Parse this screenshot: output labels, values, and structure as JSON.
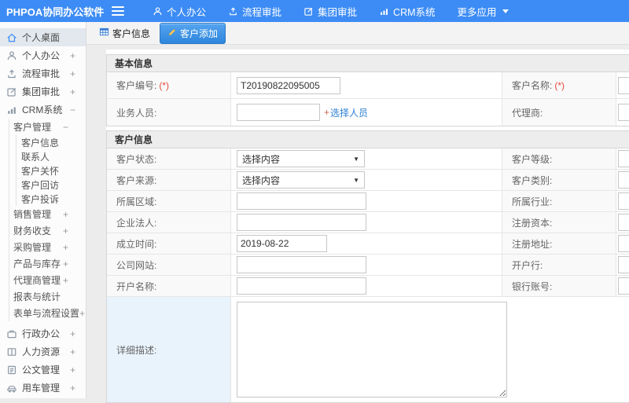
{
  "topbar": {
    "logo": "PHPOA协同办公软件",
    "menu": [
      {
        "label": "个人办公",
        "icon": "user-icon"
      },
      {
        "label": "流程审批",
        "icon": "process-icon"
      },
      {
        "label": "集团审批",
        "icon": "edit-square-icon"
      },
      {
        "label": "CRM系统",
        "icon": "bar-chart-icon"
      },
      {
        "label": "更多应用",
        "icon": "caret-down-icon"
      }
    ]
  },
  "sidebar": {
    "items_top": [
      {
        "label": "个人桌面",
        "icon": "home-icon",
        "active": true,
        "expand": ""
      },
      {
        "label": "个人办公",
        "icon": "user-icon",
        "expand": "+"
      },
      {
        "label": "流程审批",
        "icon": "process-icon",
        "expand": "+"
      },
      {
        "label": "集团审批",
        "icon": "edit-square-icon",
        "expand": "+"
      },
      {
        "label": "CRM系统",
        "icon": "bar-chart-icon",
        "expand": "−"
      }
    ],
    "customer_mgmt": {
      "label": "客户管理",
      "expand": "−"
    },
    "customer_children": [
      {
        "label": "客户信息"
      },
      {
        "label": "联系人"
      },
      {
        "label": "客户关怀"
      },
      {
        "label": "客户回访"
      },
      {
        "label": "客户投诉"
      }
    ],
    "crm_siblings": [
      {
        "label": "销售管理",
        "expand": "+"
      },
      {
        "label": "财务收支",
        "expand": "+"
      },
      {
        "label": "采购管理",
        "expand": "+"
      },
      {
        "label": "产品与库存",
        "expand": "+"
      },
      {
        "label": "代理商管理",
        "expand": "+"
      },
      {
        "label": "报表与统计",
        "expand": ""
      },
      {
        "label": "表单与流程设置",
        "expand": "+"
      }
    ],
    "items_bottom": [
      {
        "label": "行政办公",
        "icon": "briefcase-icon",
        "expand": "+"
      },
      {
        "label": "人力资源",
        "icon": "book-icon",
        "expand": "+"
      },
      {
        "label": "公文管理",
        "icon": "doc-icon",
        "expand": "+"
      },
      {
        "label": "用车管理",
        "icon": "car-icon",
        "expand": "+"
      }
    ]
  },
  "tabs": {
    "tab_list": "客户信息",
    "tab_add": "客户添加"
  },
  "form": {
    "sections": [
      {
        "title": "基本信息",
        "rows": [
          {
            "left_label": "客户编号:",
            "left_required": "(*)",
            "value": "T20190822095005",
            "right_label": "客户名称:",
            "right_required": "(*)"
          },
          {
            "left_label": "业务人员:",
            "link_plus": "+",
            "link_text": "选择人员",
            "right_label": "代理商:"
          }
        ]
      },
      {
        "title": "客户信息",
        "rows": [
          {
            "left_label": "客户状态:",
            "select_value": "选择内容",
            "right_label": "客户等级:"
          },
          {
            "left_label": "客户来源:",
            "select_value": "选择内容",
            "right_label": "客户类别:"
          },
          {
            "left_label": "所属区域:",
            "right_label": "所属行业:"
          },
          {
            "left_label": "企业法人:",
            "right_label": "注册资本:"
          },
          {
            "left_label": "成立时间:",
            "value": "2019-08-22",
            "right_label": "注册地址:"
          },
          {
            "left_label": "公司网站:",
            "right_label": "开户行:"
          },
          {
            "left_label": "开户名称:",
            "right_label": "银行账号:"
          },
          {
            "left_label": "详细描述:"
          }
        ]
      }
    ]
  },
  "colors": {
    "topbar_blue": "#3d8cf5",
    "active_tab_blue": "#2e86dd",
    "link_blue": "#2b7fd0",
    "required_red": "#e5493a",
    "desc_label_bg": "#e9f3fc",
    "sidebar_active_bg": "#e2e8ee"
  }
}
